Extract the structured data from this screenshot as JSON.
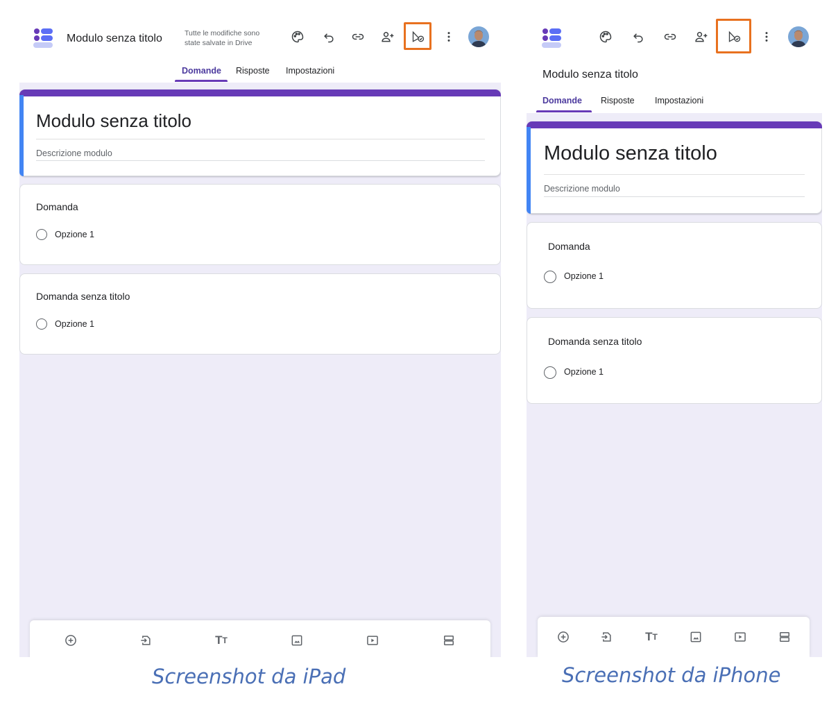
{
  "colors": {
    "accent_purple": "#673ab7",
    "accent_blue": "#4285f4",
    "highlight_orange": "#e8711f",
    "canvas_bg": "#eeecf8",
    "caption_blue": "#4a6fb5"
  },
  "ipad": {
    "app_title": "Modulo senza titolo",
    "save_status_line1": "Tutte le modifiche sono",
    "save_status_line2": "state salvate in Drive",
    "toolbar_icons": [
      "palette-icon",
      "undo-icon",
      "link-icon",
      "add-collaborator-icon",
      "publish-icon",
      "more-vert-icon",
      "avatar"
    ],
    "highlighted_icon": "publish-icon",
    "tabs": [
      {
        "label": "Domande",
        "active": true
      },
      {
        "label": "Risposte",
        "active": false
      },
      {
        "label": "Impostazioni",
        "active": false
      }
    ],
    "form_title": "Modulo senza titolo",
    "form_description_placeholder": "Descrizione modulo",
    "questions": [
      {
        "title": "Domanda",
        "option": "Opzione 1"
      },
      {
        "title": "Domanda senza titolo",
        "option": "Opzione 1"
      }
    ],
    "bottom_icons": [
      "add-question-icon",
      "import-questions-icon",
      "add-title-icon",
      "add-image-icon",
      "add-video-icon",
      "add-section-icon"
    ],
    "caption": "Screenshot da iPad"
  },
  "iphone": {
    "app_title": "Modulo senza titolo",
    "toolbar_icons": [
      "palette-icon",
      "undo-icon",
      "link-icon",
      "add-collaborator-icon",
      "publish-icon",
      "more-vert-icon",
      "avatar"
    ],
    "highlighted_icon": "publish-icon",
    "tabs": [
      {
        "label": "Domande",
        "active": true
      },
      {
        "label": "Risposte",
        "active": false
      },
      {
        "label": "Impostazioni",
        "active": false
      }
    ],
    "form_title": "Modulo senza titolo",
    "form_description_placeholder": "Descrizione modulo",
    "questions": [
      {
        "title": "Domanda",
        "option": "Opzione 1"
      },
      {
        "title": "Domanda senza titolo",
        "option": "Opzione 1"
      }
    ],
    "bottom_icons": [
      "add-question-icon",
      "import-questions-icon",
      "add-title-icon",
      "add-image-icon",
      "add-video-icon",
      "add-section-icon"
    ],
    "caption": "Screenshot da iPhone"
  }
}
